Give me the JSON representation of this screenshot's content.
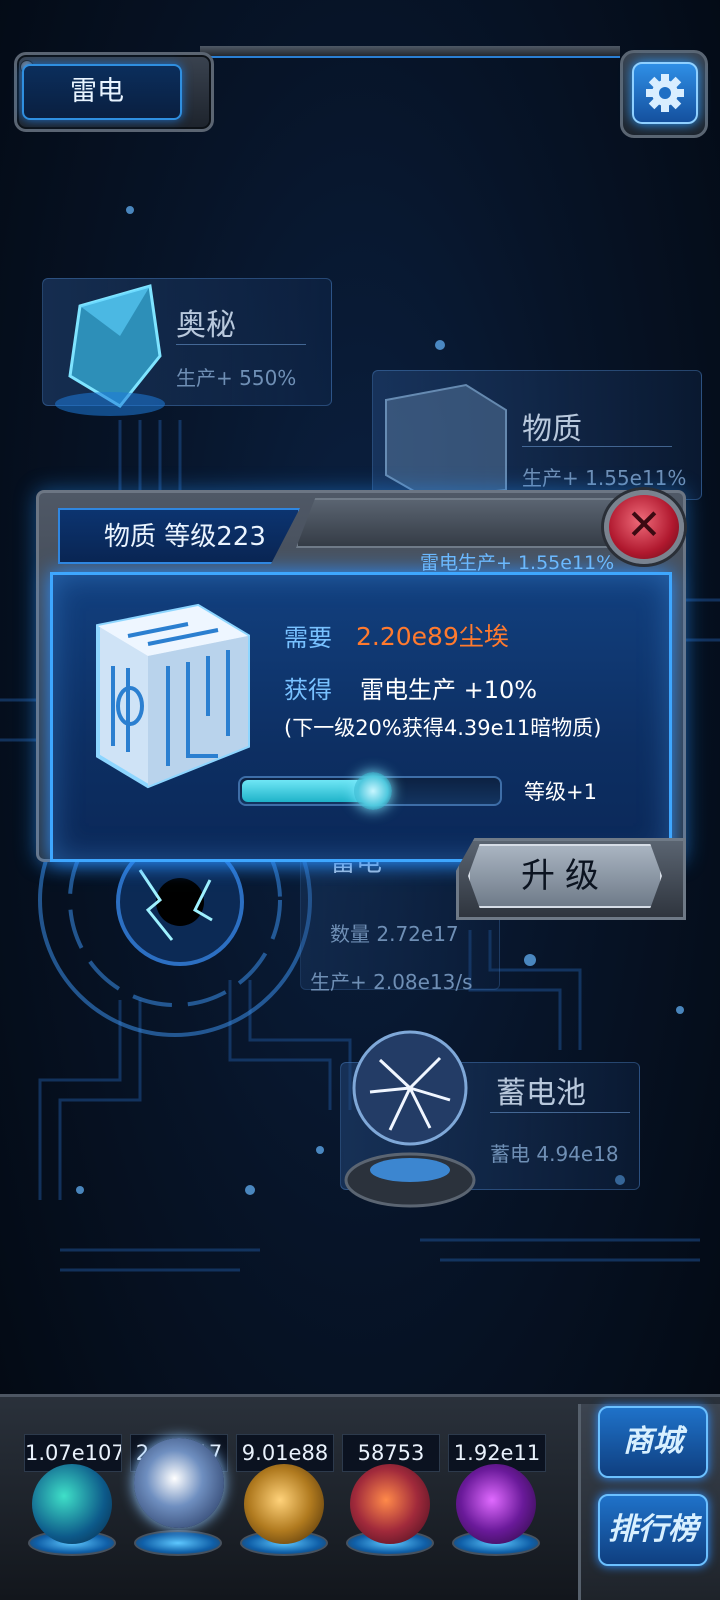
{
  "header": {
    "title": "雷电",
    "settings_icon": "gear-icon"
  },
  "nodes": {
    "mystery": {
      "name": "奥秘",
      "stat": "生产+ 550%"
    },
    "matter": {
      "name": "物质",
      "stat": "生产+ 1.55e11%"
    },
    "thunder": {
      "name": "雷电",
      "quantity": "数量 2.72e17",
      "stat": "生产+ 2.08e13/s"
    },
    "battery": {
      "name": "蓄电池",
      "stat": "蓄电 4.94e18"
    }
  },
  "dialog": {
    "title": "物质 等级223",
    "subtitle": "雷电生产+ 1.55e11%",
    "cost_label": "需要",
    "cost_value": "2.20e89尘埃",
    "gain_label": "获得",
    "gain_value": "雷电生产 +10%",
    "next_note": "(下一级20%获得4.39e11暗物质)",
    "slider_fraction": 0.52,
    "level_increment": "等级+1",
    "upgrade_label": "升级"
  },
  "bottom": {
    "resources": [
      {
        "value": "1.07e107"
      },
      {
        "value": "2.27e17"
      },
      {
        "value": "9.01e88"
      },
      {
        "value": "58753"
      },
      {
        "value": "1.92e11"
      }
    ],
    "shop_label": "商城",
    "leaderboard_label": "排行榜"
  },
  "colors": {
    "accent": "#3ea7ff",
    "cost": "#ff7a2e",
    "close": "#c4223a"
  }
}
